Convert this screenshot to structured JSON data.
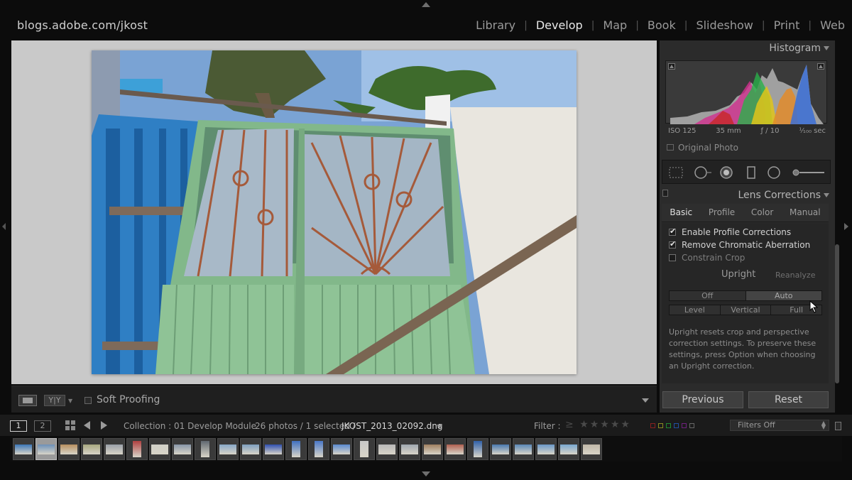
{
  "identity_plate": "blogs.adobe.com/jkost",
  "modules": [
    "Library",
    "Develop",
    "Map",
    "Book",
    "Slideshow",
    "Print",
    "Web"
  ],
  "active_module": "Develop",
  "toolbar": {
    "yy_label": "Y|Y",
    "soft_proofing_label": "Soft Proofing"
  },
  "histogram": {
    "title": "Histogram",
    "iso": "ISO 125",
    "focal_length": "35 mm",
    "aperture": "ƒ / 10",
    "shutter": "¹⁄₁₀₀ sec",
    "original_photo_label": "Original Photo"
  },
  "lens_corrections": {
    "title": "Lens Corrections",
    "tabs": [
      "Basic",
      "Profile",
      "Color",
      "Manual"
    ],
    "active_tab": "Basic",
    "enable_profile": "Enable Profile Corrections",
    "remove_ca": "Remove Chromatic Aberration",
    "constrain_crop": "Constrain Crop",
    "upright_label": "Upright",
    "reanalyze": "Reanalyze",
    "upright_row1": [
      "Off",
      "Auto"
    ],
    "upright_row2": [
      "Level",
      "Vertical",
      "Full"
    ],
    "description": "Upright resets crop and perspective correction settings. To preserve these settings, press Option when choosing an Upright correction.",
    "previous_button": "Previous",
    "reset_button": "Reset"
  },
  "filmstrip_bar": {
    "screen1": "1",
    "screen2": "2",
    "collection": "Collection : 01 Develop Module",
    "count": "26 photos / 1 selected /",
    "filename": "JKOST_2013_02092.dng",
    "filter_label": "Filter :",
    "filter_op": "≥",
    "filter_stars": "★★★★★",
    "filters_off": "Filters Off"
  },
  "colors": {
    "panel_bg": "#2b2b2b",
    "image_bg": "#c9c9c9",
    "accent_text": "#e8e8e8"
  }
}
